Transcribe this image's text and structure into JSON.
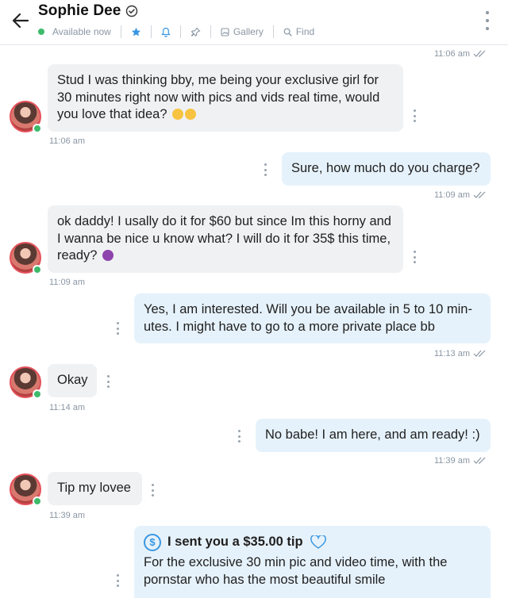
{
  "header": {
    "name": "Sophie Dee",
    "status": "Available now",
    "gallery": "Gallery",
    "find": "Find"
  },
  "messages": {
    "m0_time": "11:06 am",
    "m1_text": "Stud I was thinking bby, me being your exclusive girl for 30 minutes right now with pics and vids real time, would you love that idea?",
    "m1_time": "11:06 am",
    "m2_text": "Sure, how much do you charge?",
    "m2_time": "11:09 am",
    "m3_text": "ok daddy! I usally do it for $60 but since Im this horny and I wanna be nice u know what? I will do it for 35$ this time, ready?",
    "m3_time": "11:09 am",
    "m4_text": "Yes, I am interested. Will you be available in 5 to 10 min-utes. I might have to go to a more private place bb",
    "m4_time": "11:13 am",
    "m5_text": "Okay",
    "m5_time": "11:14 am",
    "m6_text": "No babe! I am here, and am ready! :)",
    "m6_time": "11:39 am",
    "m7_text": "Tip my lovee",
    "m7_time": "11:39 am",
    "tip_title": "I sent you a $35.00 tip",
    "tip_text": "For the exclusive 30 min pic and video time, with the pornstar who has the most beautiful smile"
  },
  "colors": {
    "online": "#3dbb6a",
    "accent": "#3a97e2",
    "incoming_bg": "#f0f1f3",
    "outgoing_bg": "#e6f2fb"
  }
}
